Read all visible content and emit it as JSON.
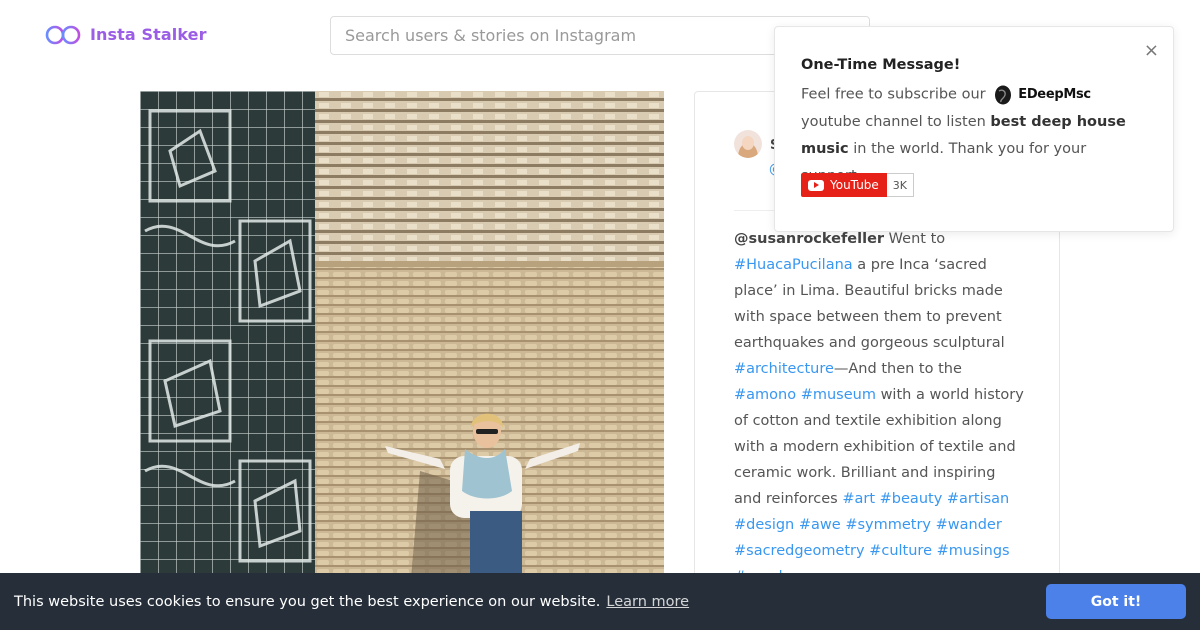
{
  "header": {
    "logo_text": "Insta Stalker",
    "search_placeholder": "Search users & stories on Instagram"
  },
  "post": {
    "author_name": "S",
    "author_handle": "@",
    "caption": [
      {
        "type": "user",
        "text": "@susanrockefeller"
      },
      {
        "type": "text",
        "text": " Went to "
      },
      {
        "type": "tag",
        "text": "#HuacaPucilana"
      },
      {
        "type": "text",
        "text": " a pre Inca ‘sacred place’ in Lima. Beautiful bricks made with space between them to prevent earthquakes and gorgeous sculptural "
      },
      {
        "type": "tag",
        "text": "#architecture"
      },
      {
        "type": "text",
        "text": "—And then to the "
      },
      {
        "type": "tag",
        "text": "#amono"
      },
      {
        "type": "text",
        "text": " "
      },
      {
        "type": "tag",
        "text": "#museum"
      },
      {
        "type": "text",
        "text": " with a world history of cotton and textile exhibition along with a modern exhibition of textile and ceramic work. Brilliant and inspiring and reinforces "
      },
      {
        "type": "tag",
        "text": "#art"
      },
      {
        "type": "text",
        "text": " "
      },
      {
        "type": "tag",
        "text": "#beauty"
      },
      {
        "type": "text",
        "text": " "
      },
      {
        "type": "tag",
        "text": "#artisan"
      },
      {
        "type": "text",
        "text": " "
      },
      {
        "type": "tag",
        "text": "#design"
      },
      {
        "type": "text",
        "text": " "
      },
      {
        "type": "tag",
        "text": "#awe"
      },
      {
        "type": "text",
        "text": " "
      },
      {
        "type": "tag",
        "text": "#symmetry"
      },
      {
        "type": "text",
        "text": " "
      },
      {
        "type": "tag",
        "text": "#wander"
      },
      {
        "type": "text",
        "text": " "
      },
      {
        "type": "tag",
        "text": "#sacredgeometry"
      },
      {
        "type": "text",
        "text": " "
      },
      {
        "type": "tag",
        "text": "#culture"
      },
      {
        "type": "text",
        "text": " "
      },
      {
        "type": "tag",
        "text": "#musings"
      },
      {
        "type": "text",
        "text": " "
      },
      {
        "type": "tag",
        "text": "#ponder"
      }
    ]
  },
  "popup": {
    "title": "One-Time Message!",
    "body_1": "Feel free to subscribe our",
    "brand_name": "EDeepMsc",
    "body_2": "youtube channel to listen",
    "body_bold": "best deep house music",
    "body_3": "in the world. Thank you for your support.",
    "close_symbol": "×",
    "youtube_label": "YouTube",
    "youtube_count": "3K"
  },
  "cookie": {
    "message": "This website uses cookies to ensure you get the best experience on our website.",
    "learn_more": "Learn more",
    "accept": "Got it!"
  },
  "colors": {
    "accent": "#9b5de5",
    "link": "#3897f0",
    "cookie_bg": "#252e39",
    "cookie_button": "#4b81e8",
    "youtube_red": "#e62117"
  }
}
